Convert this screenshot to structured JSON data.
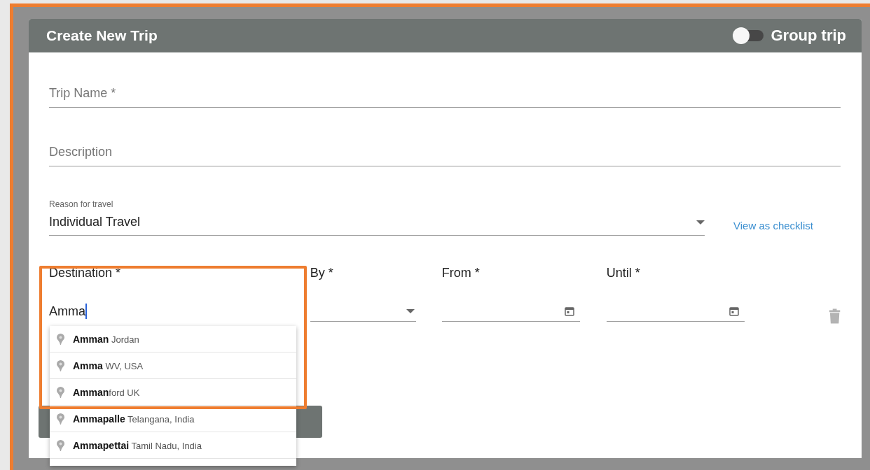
{
  "dialog": {
    "title": "Create New Trip",
    "group_trip": {
      "label": "Group trip",
      "on": false
    }
  },
  "fields": [
    {
      "placeholder": "Trip Name *"
    },
    {
      "placeholder": "Description"
    }
  ],
  "reason": {
    "label": "Reason for travel",
    "value": "Individual Travel",
    "link": "View as checklist"
  },
  "destination": {
    "label": "Destination *",
    "value": "Amma"
  },
  "by": {
    "label": "By *"
  },
  "from": {
    "label": "From *"
  },
  "until": {
    "label": "Until *"
  },
  "suggestions": [
    "**Amman** Jordan",
    "**Amma** WV, USA",
    "**Amman**ford UK",
    "**Ammapalle** Telangana, India",
    "**Ammapettai** Tamil Nadu, India"
  ]
}
